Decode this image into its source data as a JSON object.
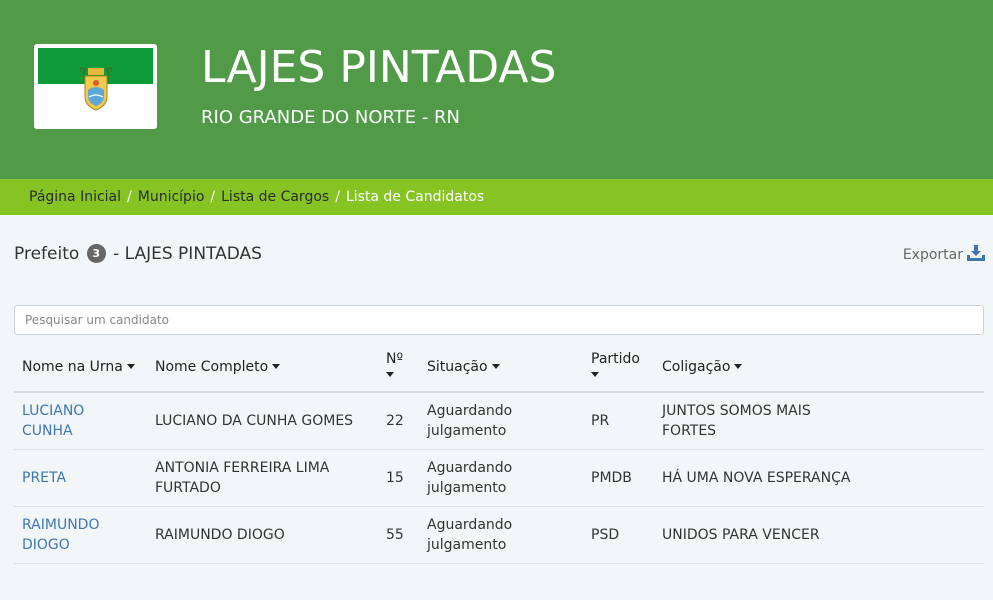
{
  "header": {
    "city": "LAJES PINTADAS",
    "state": "RIO GRANDE DO NORTE - RN",
    "flag_icon": "rio-grande-do-norte-flag",
    "colors": {
      "header_bg": "#519a48",
      "flag_green": "#0f9a3a"
    }
  },
  "breadcrumb": {
    "items": [
      "Página Inicial",
      "Município",
      "Lista de Cargos",
      "Lista de Candidatos"
    ],
    "separator": "/",
    "bg_color": "#86c424"
  },
  "page": {
    "cargo": "Prefeito",
    "count": "3",
    "suffix": "- LAJES PINTADAS",
    "export_label": "Exportar",
    "export_icon": "download-icon"
  },
  "search": {
    "placeholder": "Pesquisar um candidato",
    "value": ""
  },
  "table": {
    "headers": {
      "nome_urna": "Nome na Urna",
      "nome_completo": "Nome Completo",
      "numero": "Nº",
      "situacao": "Situação",
      "partido": "Partido",
      "coligacao": "Coligação"
    },
    "rows": [
      {
        "nome_urna": "LUCIANO CUNHA",
        "nome_completo": "LUCIANO DA CUNHA GOMES",
        "numero": "22",
        "situacao": "Aguardando julgamento",
        "partido": "PR",
        "coligacao": "JUNTOS SOMOS MAIS FORTES"
      },
      {
        "nome_urna": "PRETA",
        "nome_completo": "ANTONIA FERREIRA LIMA FURTADO",
        "numero": "15",
        "situacao": "Aguardando julgamento",
        "partido": "PMDB",
        "coligacao": "HÁ UMA NOVA ESPERANÇA"
      },
      {
        "nome_urna": "RAIMUNDO DIOGO",
        "nome_completo": "RAIMUNDO DIOGO",
        "numero": "55",
        "situacao": "Aguardando julgamento",
        "partido": "PSD",
        "coligacao": "UNIDOS PARA VENCER"
      }
    ]
  }
}
